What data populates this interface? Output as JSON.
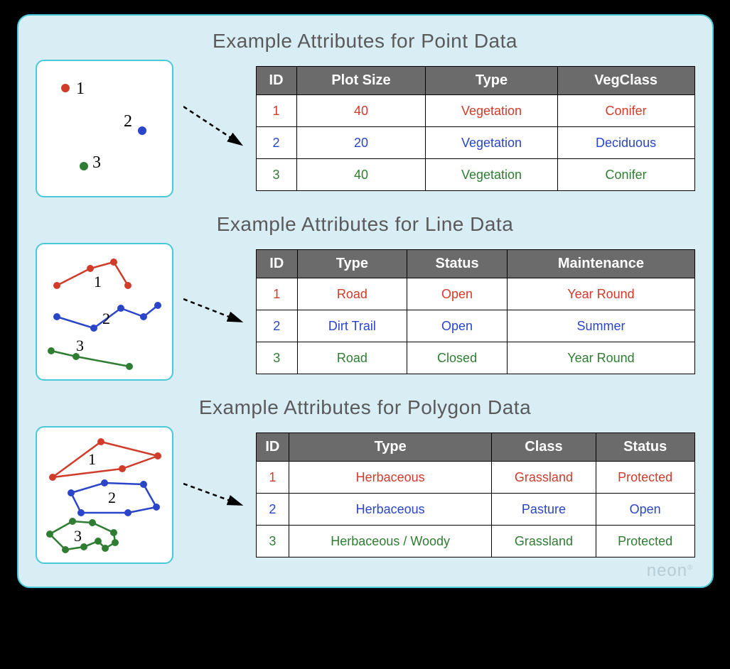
{
  "logo": "neon",
  "sections": [
    {
      "title": "Example Attributes for Point Data",
      "headers": [
        "ID",
        "Plot Size",
        "Type",
        "VegClass"
      ],
      "rows": [
        {
          "color": "c-red",
          "cells": [
            "1",
            "40",
            "Vegetation",
            "Conifer"
          ]
        },
        {
          "color": "c-blue",
          "cells": [
            "2",
            "20",
            "Vegetation",
            "Deciduous"
          ]
        },
        {
          "color": "c-green",
          "cells": [
            "3",
            "40",
            "Vegetation",
            "Conifer"
          ]
        }
      ],
      "map_labels": [
        "1",
        "2",
        "3"
      ]
    },
    {
      "title": "Example Attributes for Line Data",
      "headers": [
        "ID",
        "Type",
        "Status",
        "Maintenance"
      ],
      "rows": [
        {
          "color": "c-red",
          "cells": [
            "1",
            "Road",
            "Open",
            "Year Round"
          ]
        },
        {
          "color": "c-blue",
          "cells": [
            "2",
            "Dirt Trail",
            "Open",
            "Summer"
          ]
        },
        {
          "color": "c-green",
          "cells": [
            "3",
            "Road",
            "Closed",
            "Year Round"
          ]
        }
      ],
      "map_labels": [
        "1",
        "2",
        "3"
      ]
    },
    {
      "title": "Example Attributes for Polygon Data",
      "headers": [
        "ID",
        "Type",
        "Class",
        "Status"
      ],
      "rows": [
        {
          "color": "c-red",
          "cells": [
            "1",
            "Herbaceous",
            "Grassland",
            "Protected"
          ]
        },
        {
          "color": "c-blue",
          "cells": [
            "2",
            "Herbaceous",
            "Pasture",
            "Open"
          ]
        },
        {
          "color": "c-green",
          "cells": [
            "3",
            "Herbaceous / Woody",
            "Grassland",
            "Protected"
          ],
          "small_col": 1
        }
      ],
      "map_labels": [
        "1",
        "2",
        "3"
      ]
    }
  ]
}
